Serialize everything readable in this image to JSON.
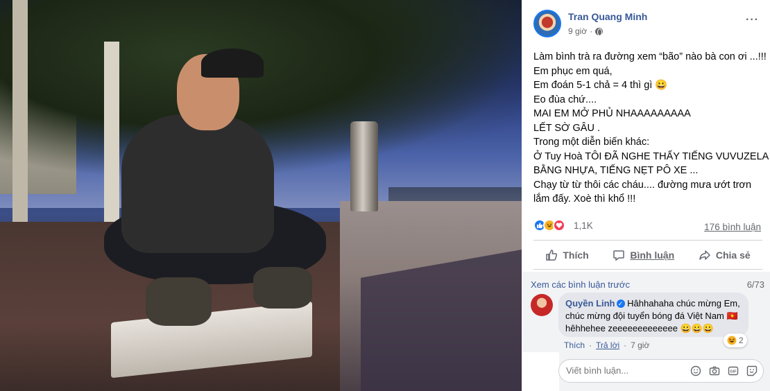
{
  "post": {
    "author": "Tran Quang Minh",
    "time": "9 giờ",
    "more": "···",
    "text_lines": [
      "Làm bình trà ra đường xem “bão” nào bà con ơi ...!!!",
      "Em phục em quá,",
      "Em đoán 5-1 chả = 4 thì gì 😀",
      "Eo đùa chứ....",
      "MAI EM MỞ PHỦ NHAAAAAAAAA",
      "LẾT SỜ GÂU .",
      "Trong một diễn biến khác:",
      "Ở Tuy Hoà TÔI ĐÃ NGHE THẤY TIẾNG VUVUZELA",
      "BẰNG NHỰA, TIẾNG NẸT PÔ XE ...",
      "Chạy từ từ thôi các cháu.... đường mưa ướt trơn",
      "lắm đấy. Xoè thì khổ !!!"
    ]
  },
  "reactions": {
    "count": "1,1K",
    "comments": "176 bình luận"
  },
  "actions": {
    "like": "Thích",
    "comment": "Bình luận",
    "share": "Chia sẻ"
  },
  "comments_section": {
    "view_previous": "Xem các bình luận trước",
    "page": "6/73",
    "comment": {
      "name": "Quyền Linh",
      "text": " Hâhhahaha chúc mừng Em, chúc mừng đội tuyển bóng đá Việt Nam 🇻🇳 hêhhehee zeeeeeeeeeeeee 😀😀😀",
      "like": "Thích",
      "reply": "Trả lời",
      "time": "7 giờ",
      "reaction_count": "2"
    },
    "write_placeholder": "Viết bình luận..."
  },
  "icons": {
    "globe": "globe-icon",
    "emoji": "emoji-icon",
    "camera": "camera-icon",
    "gif": "gif-icon",
    "sticker": "sticker-icon"
  },
  "colors": {
    "link": "#385898",
    "accent": "#1877f2",
    "muted": "#65676b",
    "comment_bg": "#f2f3f5"
  }
}
